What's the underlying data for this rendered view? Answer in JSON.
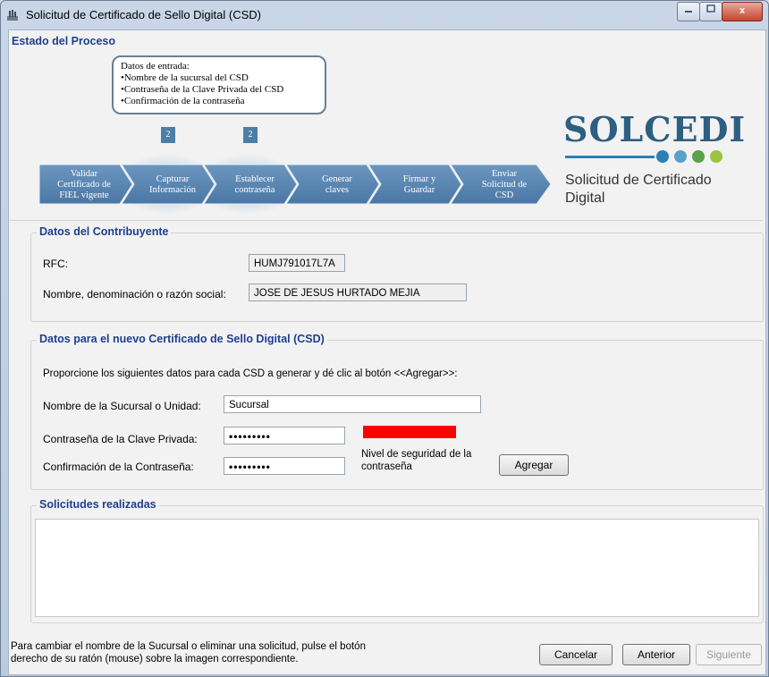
{
  "window": {
    "title": "Solicitud de Certificado de Sello Digital (CSD)",
    "close_symbol": "x"
  },
  "process": {
    "group_title": "Estado del Proceso",
    "callout_heading": "Datos de entrada:",
    "callout_items": [
      "•Nombre de la sucursal del CSD",
      "•Contraseña de la Clave Privada del CSD",
      "•Confirmación de la contraseña"
    ],
    "badges": [
      "2",
      "2"
    ],
    "steps": [
      {
        "line1": "Validar",
        "line2": "Certificado de",
        "line3": "FIEL vigente"
      },
      {
        "line1": "Capturar",
        "line2": "Información",
        "line3": ""
      },
      {
        "line1": "Establecer",
        "line2": "contraseña",
        "line3": ""
      },
      {
        "line1": "Generar",
        "line2": "claves",
        "line3": ""
      },
      {
        "line1": "Firmar y",
        "line2": "Guardar",
        "line3": ""
      },
      {
        "line1": "Enviar",
        "line2": "Solicitud de",
        "line3": "CSD"
      }
    ]
  },
  "logo": {
    "name": "SOLCEDI",
    "subtitle": "Solicitud de Certificado Digital",
    "dot_colors": [
      "#2d7fb3",
      "#5aa0c8",
      "#59a14a",
      "#9bc43f"
    ]
  },
  "contribuyente": {
    "group_title": "Datos del Contribuyente",
    "rfc_label": "RFC:",
    "rfc_value": "HUMJ791017L7A",
    "name_label": "Nombre, denominación o razón social:",
    "name_value": "JOSE DE JESUS HURTADO MEJIA"
  },
  "csd": {
    "group_title": "Datos para el nuevo Certificado de Sello Digital (CSD)",
    "instructions": "Proporcione los siguientes datos para cada CSD a generar y dé clic al botón <<Agregar>>:",
    "sucursal_label": "Nombre de la Sucursal o Unidad:",
    "sucursal_value": "Sucursal",
    "password_label": "Contraseña de la Clave Privada:",
    "password_value": "•••••••••",
    "confirm_label": "Confirmación de la Contraseña:",
    "confirm_value": "•••••••••",
    "strength_label": "Nivel de seguridad de la contraseña",
    "strength_color": "#ff0000",
    "add_button": "Agregar"
  },
  "solicitudes": {
    "group_title": "Solicitudes realizadas"
  },
  "footer": {
    "hint_line1": "Para cambiar el nombre de la Sucursal o eliminar una solicitud, pulse el botón",
    "hint_line2": "derecho de su ratón (mouse) sobre la imagen correspondiente.",
    "cancel_button": "Cancelar",
    "back_button": "Anterior",
    "next_button": "Siguiente"
  }
}
